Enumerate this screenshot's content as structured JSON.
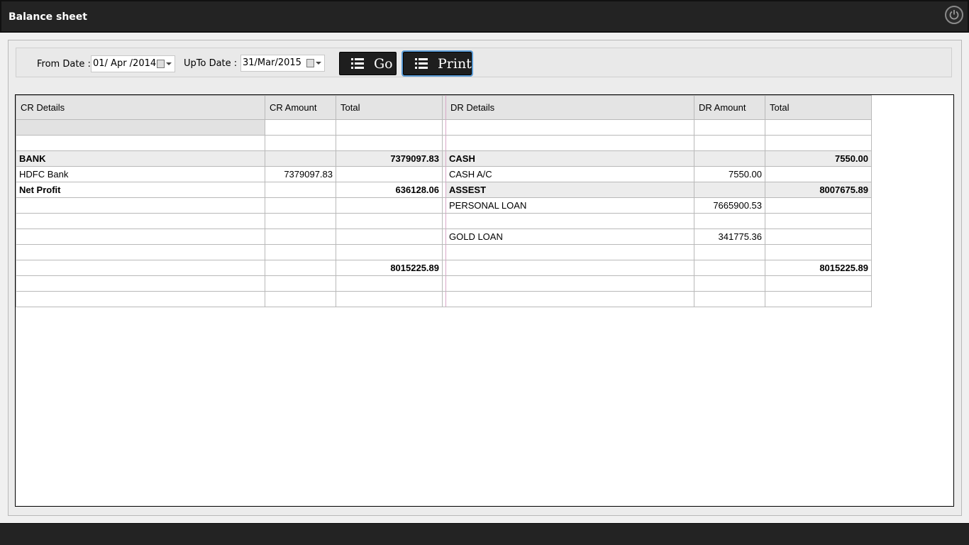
{
  "window": {
    "title": "Balance sheet"
  },
  "filters": {
    "from_label": "From Date :",
    "from_value": "01/ Apr /2014",
    "upto_label": "UpTo Date :",
    "upto_value": "31/Mar/2015",
    "go_label": "Go",
    "print_label": "Print"
  },
  "table": {
    "headers": [
      "CR Details",
      "CR Amount",
      "Total",
      "DR Details",
      "DR Amount",
      "Total"
    ],
    "rows": [
      {
        "cr_details": "",
        "cr_amount": "",
        "cr_total": "",
        "dr_details": "",
        "dr_amount": "",
        "dr_total": "",
        "style": "first"
      },
      {
        "cr_details": "",
        "cr_amount": "",
        "cr_total": "",
        "dr_details": "",
        "dr_amount": "",
        "dr_total": "",
        "style": ""
      },
      {
        "cr_details": "BANK",
        "cr_amount": "",
        "cr_total": "7379097.83",
        "dr_details": "CASH",
        "dr_amount": "",
        "dr_total": "7550.00",
        "style": "group"
      },
      {
        "cr_details": "HDFC Bank",
        "cr_amount": "7379097.83",
        "cr_total": "",
        "dr_details": "CASH A/C",
        "dr_amount": "7550.00",
        "dr_total": "",
        "style": ""
      },
      {
        "cr_details": "Net Profit",
        "cr_amount": "",
        "cr_total": "636128.06",
        "dr_details": "ASSEST",
        "dr_amount": "",
        "dr_total": "8007675.89",
        "style": "mixed"
      },
      {
        "cr_details": "",
        "cr_amount": "",
        "cr_total": "",
        "dr_details": "PERSONAL LOAN",
        "dr_amount": "7665900.53",
        "dr_total": "",
        "style": ""
      },
      {
        "cr_details": "",
        "cr_amount": "",
        "cr_total": "",
        "dr_details": "",
        "dr_amount": "",
        "dr_total": "",
        "style": ""
      },
      {
        "cr_details": "",
        "cr_amount": "",
        "cr_total": "",
        "dr_details": "GOLD LOAN",
        "dr_amount": "341775.36",
        "dr_total": "",
        "style": ""
      },
      {
        "cr_details": "",
        "cr_amount": "",
        "cr_total": "",
        "dr_details": "",
        "dr_amount": "",
        "dr_total": "",
        "style": ""
      },
      {
        "cr_details": "",
        "cr_amount": "",
        "cr_total": "8015225.89",
        "dr_details": "",
        "dr_amount": "",
        "dr_total": "8015225.89",
        "style": "bold"
      },
      {
        "cr_details": "",
        "cr_amount": "",
        "cr_total": "",
        "dr_details": "",
        "dr_amount": "",
        "dr_total": "",
        "style": ""
      },
      {
        "cr_details": "",
        "cr_amount": "",
        "cr_total": "",
        "dr_details": "",
        "dr_amount": "",
        "dr_total": "",
        "style": ""
      }
    ]
  },
  "icons": {
    "close": "power-icon",
    "go": "list-icon",
    "print": "list-icon",
    "date": "calendar-icon"
  }
}
